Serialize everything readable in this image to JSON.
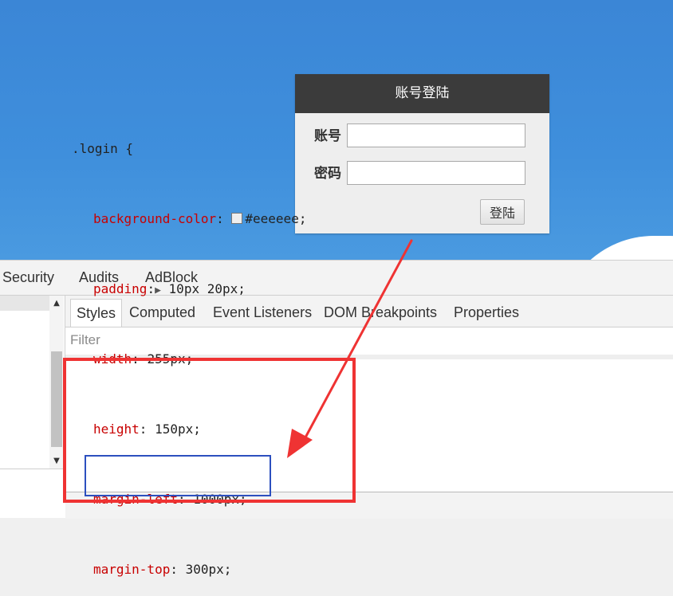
{
  "login": {
    "title": "账号登陆",
    "account_label": "账号",
    "account_value": "",
    "password_label": "密码",
    "password_value": "",
    "submit_label": "登陆"
  },
  "devtools": {
    "top_tabs": [
      "Security",
      "Audits",
      "AdBlock"
    ],
    "sub_tabs": [
      "Styles",
      "Computed",
      "Event Listeners",
      "DOM Breakpoints",
      "Properties"
    ],
    "filter_placeholder": "Filter",
    "scroll_up_glyph": "▲",
    "scroll_down_glyph": "▼",
    "css_rule": {
      "selector_line": ".login {",
      "declarations": [
        {
          "prop": "background-color",
          "value": "#eeeeee;"
        },
        {
          "prop": "padding",
          "value": "10px 20px;"
        },
        {
          "prop": "width",
          "value": "255px;"
        },
        {
          "prop": "height",
          "value": "150px;"
        },
        {
          "prop": "margin-left",
          "value": "1000px;"
        },
        {
          "prop": "margin-top",
          "value": "300px;"
        }
      ],
      "swatch_color": "#eeeeee",
      "expand_glyph": "▶"
    }
  },
  "colors": {
    "page_background": "#3f8fdc",
    "login_header": "#3b3b3b",
    "login_body": "#eeeeee",
    "css_property": "#c80000",
    "annotation_red": "#ef3333",
    "annotation_blue": "#2c4fbf"
  }
}
